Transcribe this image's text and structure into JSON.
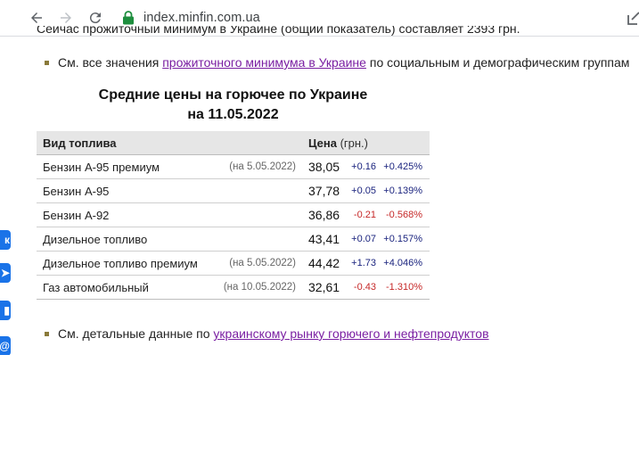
{
  "browser": {
    "url": "index.minfin.com.ua"
  },
  "intro": {
    "cut_text": "Сейчас прожиточный минимум в Украине (общий показатель) составляет 2393 грн.",
    "bullet1_prefix": "См. все значения ",
    "bullet1_link": "прожиточного минимума в Украине",
    "bullet1_suffix": " по социальным и демографическим группам"
  },
  "title": {
    "line1": "Средние цены на горючее по Украине",
    "line2": "на 11.05.2022"
  },
  "table": {
    "header_name": "Вид топлива",
    "header_price": "Цена",
    "header_unit": " (грн.)",
    "rows": [
      {
        "name": "Бензин А-95 премиум",
        "date": "(на 5.05.2022)",
        "price": "38,05",
        "abs": "+0.16",
        "pct": "+0.425%",
        "dir": "pos"
      },
      {
        "name": "Бензин А-95",
        "date": "",
        "price": "37,78",
        "abs": "+0.05",
        "pct": "+0.139%",
        "dir": "pos"
      },
      {
        "name": "Бензин А-92",
        "date": "",
        "price": "36,86",
        "abs": "-0.21",
        "pct": "-0.568%",
        "dir": "neg"
      },
      {
        "name": "Дизельное топливо",
        "date": "",
        "price": "43,41",
        "abs": "+0.07",
        "pct": "+0.157%",
        "dir": "pos"
      },
      {
        "name": "Дизельное топливо премиум",
        "date": "(на 5.05.2022)",
        "price": "44,42",
        "abs": "+1.73",
        "pct": "+4.046%",
        "dir": "pos"
      },
      {
        "name": "Газ автомобильный",
        "date": "(на 10.05.2022)",
        "price": "32,61",
        "abs": "-0.43",
        "pct": "-1.310%",
        "dir": "neg"
      }
    ]
  },
  "footer": {
    "bullet2_prefix": "См. детальные данные по ",
    "bullet2_link": "украинскому рынку горючего и нефтепродуктов"
  },
  "social": [
    "vk-icon",
    "telegram-icon",
    "stats-icon",
    "mail-icon"
  ],
  "colors": {
    "link": "#7a1fa2",
    "positive": "#1a237e",
    "negative": "#c62828",
    "lock": "#1e8e3e",
    "social": "#1a73e8"
  }
}
